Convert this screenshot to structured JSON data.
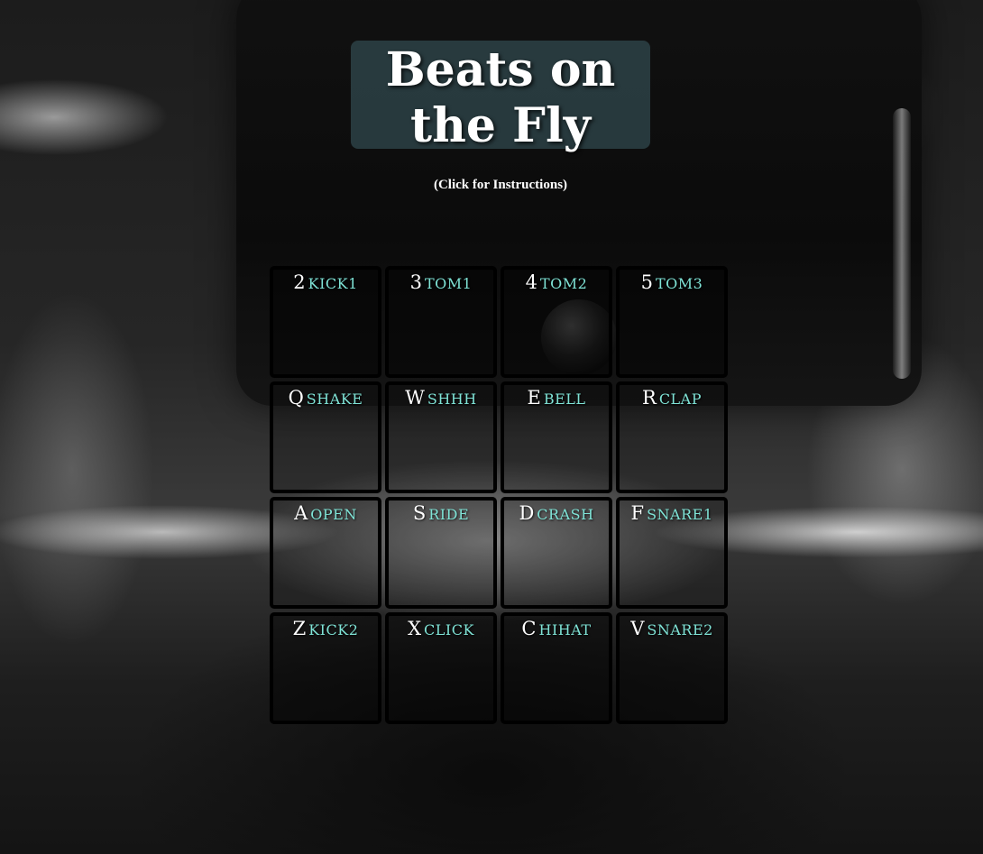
{
  "header": {
    "title": "Beats on the Fly",
    "instructions_link": "(Click for Instructions)"
  },
  "pads": [
    {
      "key": "2",
      "sound": "kick1"
    },
    {
      "key": "3",
      "sound": "tom1"
    },
    {
      "key": "4",
      "sound": "tom2"
    },
    {
      "key": "5",
      "sound": "tom3"
    },
    {
      "key": "Q",
      "sound": "shake"
    },
    {
      "key": "W",
      "sound": "shhh"
    },
    {
      "key": "E",
      "sound": "bell"
    },
    {
      "key": "R",
      "sound": "clap"
    },
    {
      "key": "A",
      "sound": "open"
    },
    {
      "key": "S",
      "sound": "ride"
    },
    {
      "key": "D",
      "sound": "crash"
    },
    {
      "key": "F",
      "sound": "snare1"
    },
    {
      "key": "Z",
      "sound": "kick2"
    },
    {
      "key": "X",
      "sound": "click"
    },
    {
      "key": "C",
      "sound": "hihat"
    },
    {
      "key": "V",
      "sound": "snare2"
    }
  ],
  "colors": {
    "sound_label": "#7fe3d6",
    "title_box": "#466e78"
  }
}
